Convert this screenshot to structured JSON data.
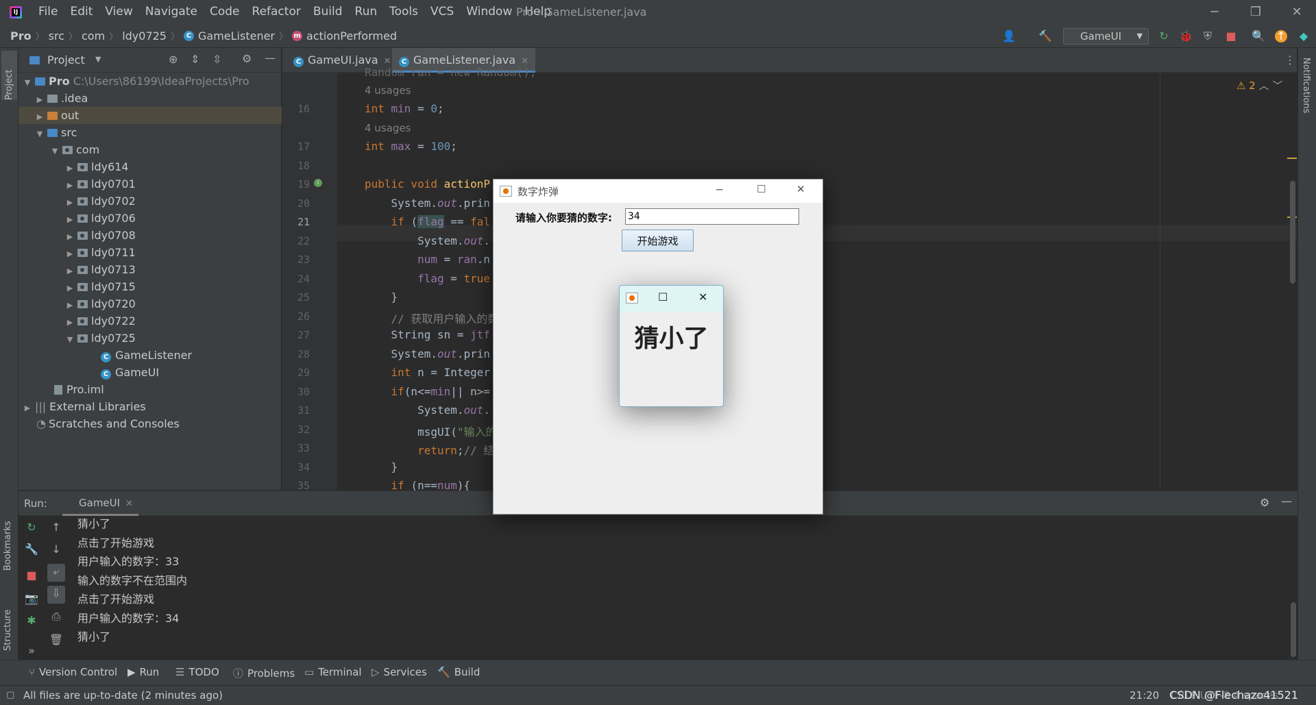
{
  "app": {
    "window_title": "Pro - GameListener.java"
  },
  "menu": [
    "File",
    "Edit",
    "View",
    "Navigate",
    "Code",
    "Refactor",
    "Build",
    "Run",
    "Tools",
    "VCS",
    "Window",
    "Help"
  ],
  "breadcrumb": [
    "Pro",
    "src",
    "com",
    "ldy0725",
    "GameListener",
    "actionPerformed"
  ],
  "run_config": "GameUI",
  "project_panel": {
    "title": "Project",
    "root_name": "Pro",
    "root_path": "C:\\Users\\86199\\IdeaProjects\\Pro",
    "items": [
      ".idea",
      "out",
      "src",
      "com",
      "ldy614",
      "ldy0701",
      "ldy0702",
      "ldy0706",
      "ldy0708",
      "ldy0711",
      "ldy0713",
      "ldy0715",
      "ldy0720",
      "ldy0722",
      "ldy0725",
      "GameListener",
      "GameUI",
      "Pro.iml",
      "External Libraries",
      "Scratches and Consoles"
    ]
  },
  "editor": {
    "tabs": [
      "GameUI.java",
      "GameListener.java"
    ],
    "warnings": "2",
    "usages": "4 usages",
    "lines": [
      {
        "n": "16"
      },
      {
        "n": "17"
      },
      {
        "n": "18"
      },
      {
        "n": "19"
      },
      {
        "n": "20"
      },
      {
        "n": "21"
      },
      {
        "n": "22"
      },
      {
        "n": "23"
      },
      {
        "n": "24"
      },
      {
        "n": "25"
      },
      {
        "n": "26"
      },
      {
        "n": "27"
      },
      {
        "n": "28"
      },
      {
        "n": "29"
      },
      {
        "n": "30"
      },
      {
        "n": "31"
      },
      {
        "n": "32"
      },
      {
        "n": "33"
      },
      {
        "n": "34"
      },
      {
        "n": "35"
      }
    ]
  },
  "run_panel": {
    "label": "Run:",
    "tab": "GameUI",
    "output": [
      "猜小了",
      "点击了开始游戏",
      "用户输入的数字：33",
      "输入的数字不在范围内",
      "点击了开始游戏",
      "用户输入的数字：34",
      "猜小了"
    ]
  },
  "bottom_tools": [
    "Version Control",
    "Run",
    "TODO",
    "Problems",
    "Terminal",
    "Services",
    "Build"
  ],
  "side_labels": {
    "project": "Project",
    "bookmarks": "Bookmarks",
    "structure": "Structure",
    "notifications": "Notifications"
  },
  "status": {
    "message": "All files are up-to-date (2 minutes ago)",
    "position": "21:20",
    "encoding": "CRLF  UTF-8  4 spaces",
    "watermark": "CSDN @Flechazo41521"
  },
  "swing_window": {
    "title": "数字炸弹",
    "prompt": "请输入你要猜的数字:",
    "input_value": "34",
    "button": "开始游戏"
  },
  "popup": {
    "message": "猜小了"
  }
}
